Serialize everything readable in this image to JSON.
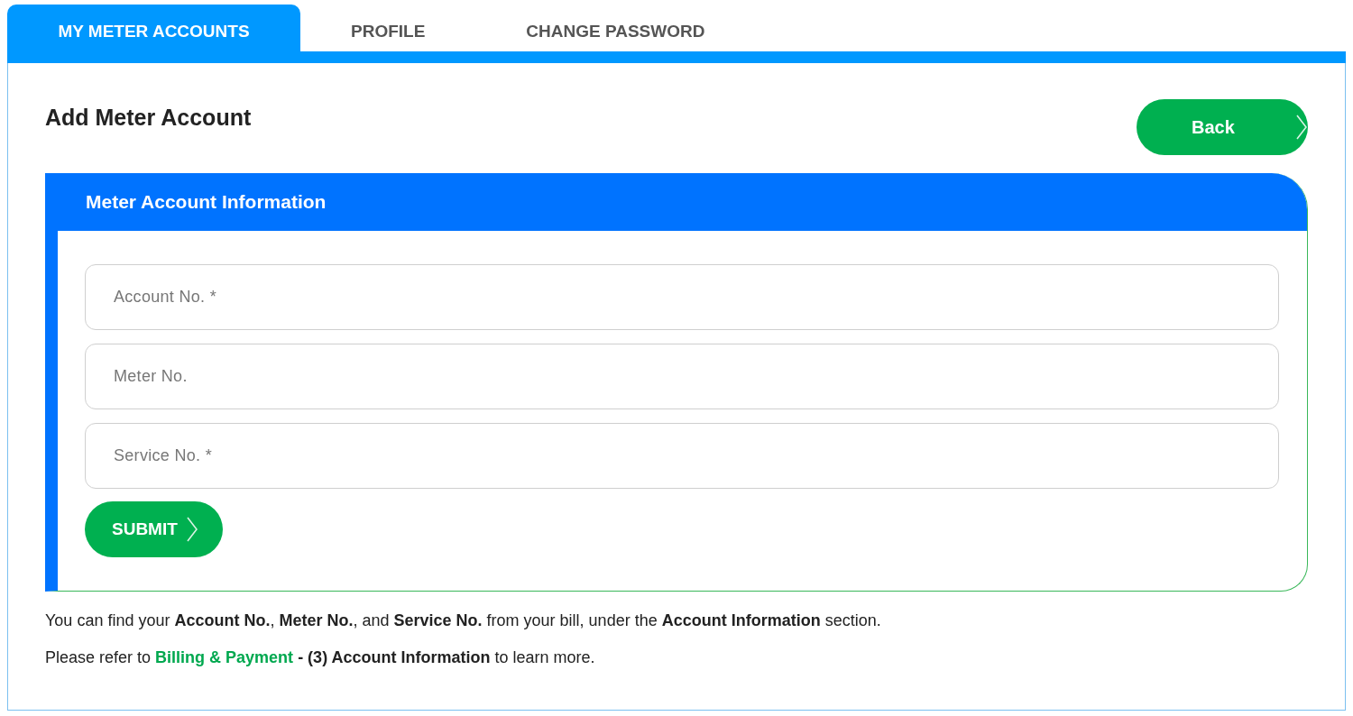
{
  "tabs": [
    {
      "label": "MY METER ACCOUNTS",
      "selected": true
    },
    {
      "label": "PROFILE",
      "selected": false
    },
    {
      "label": "CHANGE PASSWORD",
      "selected": false
    }
  ],
  "page_title": "Add Meter Account",
  "back_button": "Back",
  "card": {
    "title": "Meter Account Information",
    "fields": [
      {
        "placeholder": "Account No. *"
      },
      {
        "placeholder": "Meter No."
      },
      {
        "placeholder": "Service No. *"
      }
    ],
    "submit_button": "SUBMIT"
  },
  "help_note": "You can find your **Account No.**, **Meter No.**, and **Service No.** from your bill, under the **Account Information** section.",
  "refer_note": {
    "before": "Please refer to",
    "link": "Billing & Payment",
    "after": "**- (3) Account Information** to learn more."
  }
}
